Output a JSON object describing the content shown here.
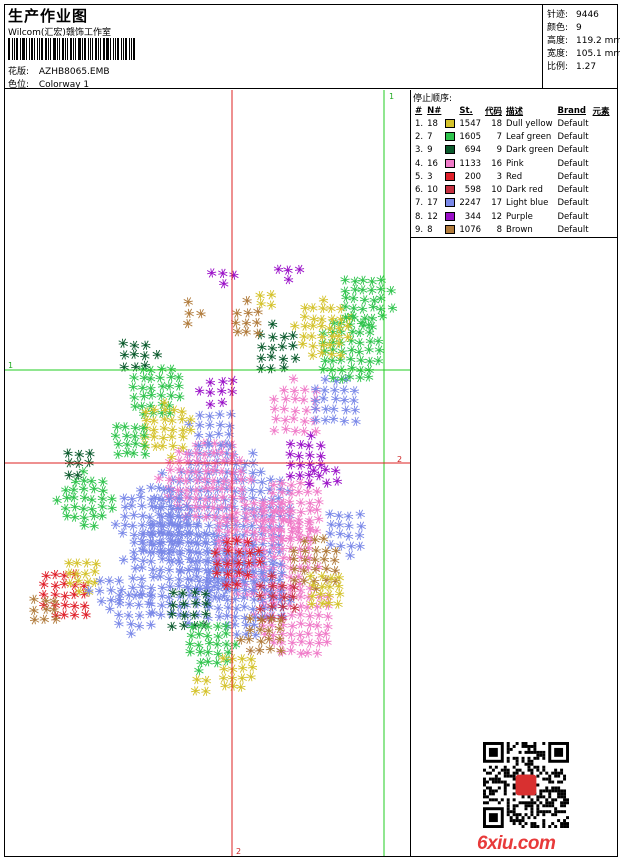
{
  "header": {
    "title": "生产作业图",
    "company": "Wilcom(汇宏)赣饰工作室",
    "design_label": "花版:",
    "design_value": "AZHB8065.EMB",
    "colorway_label": "色位:",
    "colorway_value": "Colorway 1"
  },
  "stats": [
    {
      "label": "针迹:",
      "value": "9446"
    },
    {
      "label": "颜色:",
      "value": "9"
    },
    {
      "label": "高度:",
      "value": "119.2 mm"
    },
    {
      "label": "宽度:",
      "value": "105.1 mm"
    },
    {
      "label": "比例:",
      "value": "1.27"
    }
  ],
  "color_table": {
    "title": "停止顺序:",
    "headers": [
      "#",
      "N#",
      "St.",
      "代码",
      "描述",
      "Brand",
      "元素"
    ],
    "rows": [
      {
        "idx": "1.",
        "n": "18",
        "color": "#d4c22a",
        "st": "1547",
        "code": "18",
        "desc": "Dull yellow",
        "brand": "Default"
      },
      {
        "idx": "2.",
        "n": "7",
        "color": "#2fc44d",
        "st": "1605",
        "code": "7",
        "desc": "Leaf green",
        "brand": "Default"
      },
      {
        "idx": "3.",
        "n": "9",
        "color": "#0a5a2c",
        "st": "694",
        "code": "9",
        "desc": "Dark green",
        "brand": "Default"
      },
      {
        "idx": "4.",
        "n": "16",
        "color": "#f07ac8",
        "st": "1133",
        "code": "16",
        "desc": "Pink",
        "brand": "Default"
      },
      {
        "idx": "5.",
        "n": "3",
        "color": "#e0202a",
        "st": "200",
        "code": "3",
        "desc": "Red",
        "brand": "Default"
      },
      {
        "idx": "6.",
        "n": "10",
        "color": "#c43040",
        "st": "598",
        "code": "10",
        "desc": "Dark red",
        "brand": "Default"
      },
      {
        "idx": "7.",
        "n": "17",
        "color": "#7a88e8",
        "st": "2247",
        "code": "17",
        "desc": "Light blue",
        "brand": "Default"
      },
      {
        "idx": "8.",
        "n": "12",
        "color": "#9a10c8",
        "st": "344",
        "code": "12",
        "desc": "Purple",
        "brand": "Default"
      },
      {
        "idx": "9.",
        "n": "8",
        "color": "#b07a3a",
        "st": "1076",
        "code": "8",
        "desc": "Brown",
        "brand": "Default"
      }
    ]
  },
  "guides": {
    "h1": "1",
    "v1": "1",
    "h2": "2",
    "v2": "2"
  },
  "watermark": "6xiu.com"
}
